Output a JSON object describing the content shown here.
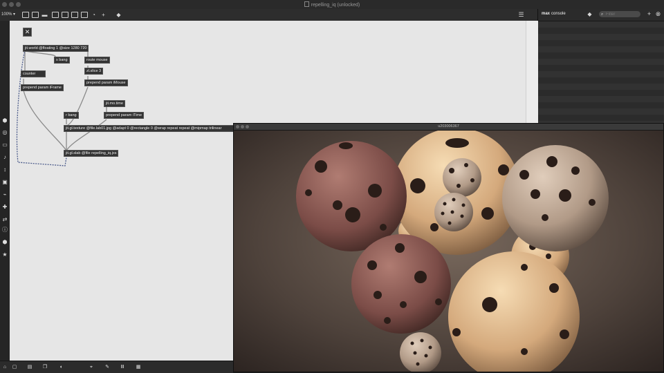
{
  "window": {
    "title": "repelling_iq (unlocked)"
  },
  "toolbar": {
    "zoom_label": "100%",
    "icons": [
      "presentation-icon",
      "inspector-icon",
      "comment-icon",
      "clear-icon",
      "capture-icon",
      "snapshot-icon",
      "grid-icon",
      "help-icon",
      "add-icon",
      "paint-bucket-icon",
      "sidebar-toggle-icon"
    ]
  },
  "console": {
    "title_bold": "max",
    "title_rest": "console",
    "filter_placeholder": "Filter"
  },
  "patcher": {
    "objects": {
      "jit_world": "jit.world @floating 1 @size 1280 720",
      "s_bang": "s bang",
      "route_mouse": "route mouse",
      "counter": "counter",
      "zl_slice": "zl.slice 3",
      "prepend_iframe": "prepend param iFrame",
      "prepend_imouse": "prepend param iMouse",
      "jit_mo_time": "jit.mo.time",
      "r_bang": "r bang",
      "prepend_itime": "prepend param iTime",
      "jit_gl_texture": "jit.gl.texture @file.lab01.jpg @adapt 0 @rectangle 0 @wrap repeat repeat @mipmap trilinear",
      "jit_gl_slab": "jit.gl.slab @file repelling_iq.jxs"
    }
  },
  "render_window": {
    "title": "u203006367"
  },
  "colors": {
    "canvas": "#e6e6e6",
    "object": "#333333",
    "wire": "#8a8a8a"
  }
}
